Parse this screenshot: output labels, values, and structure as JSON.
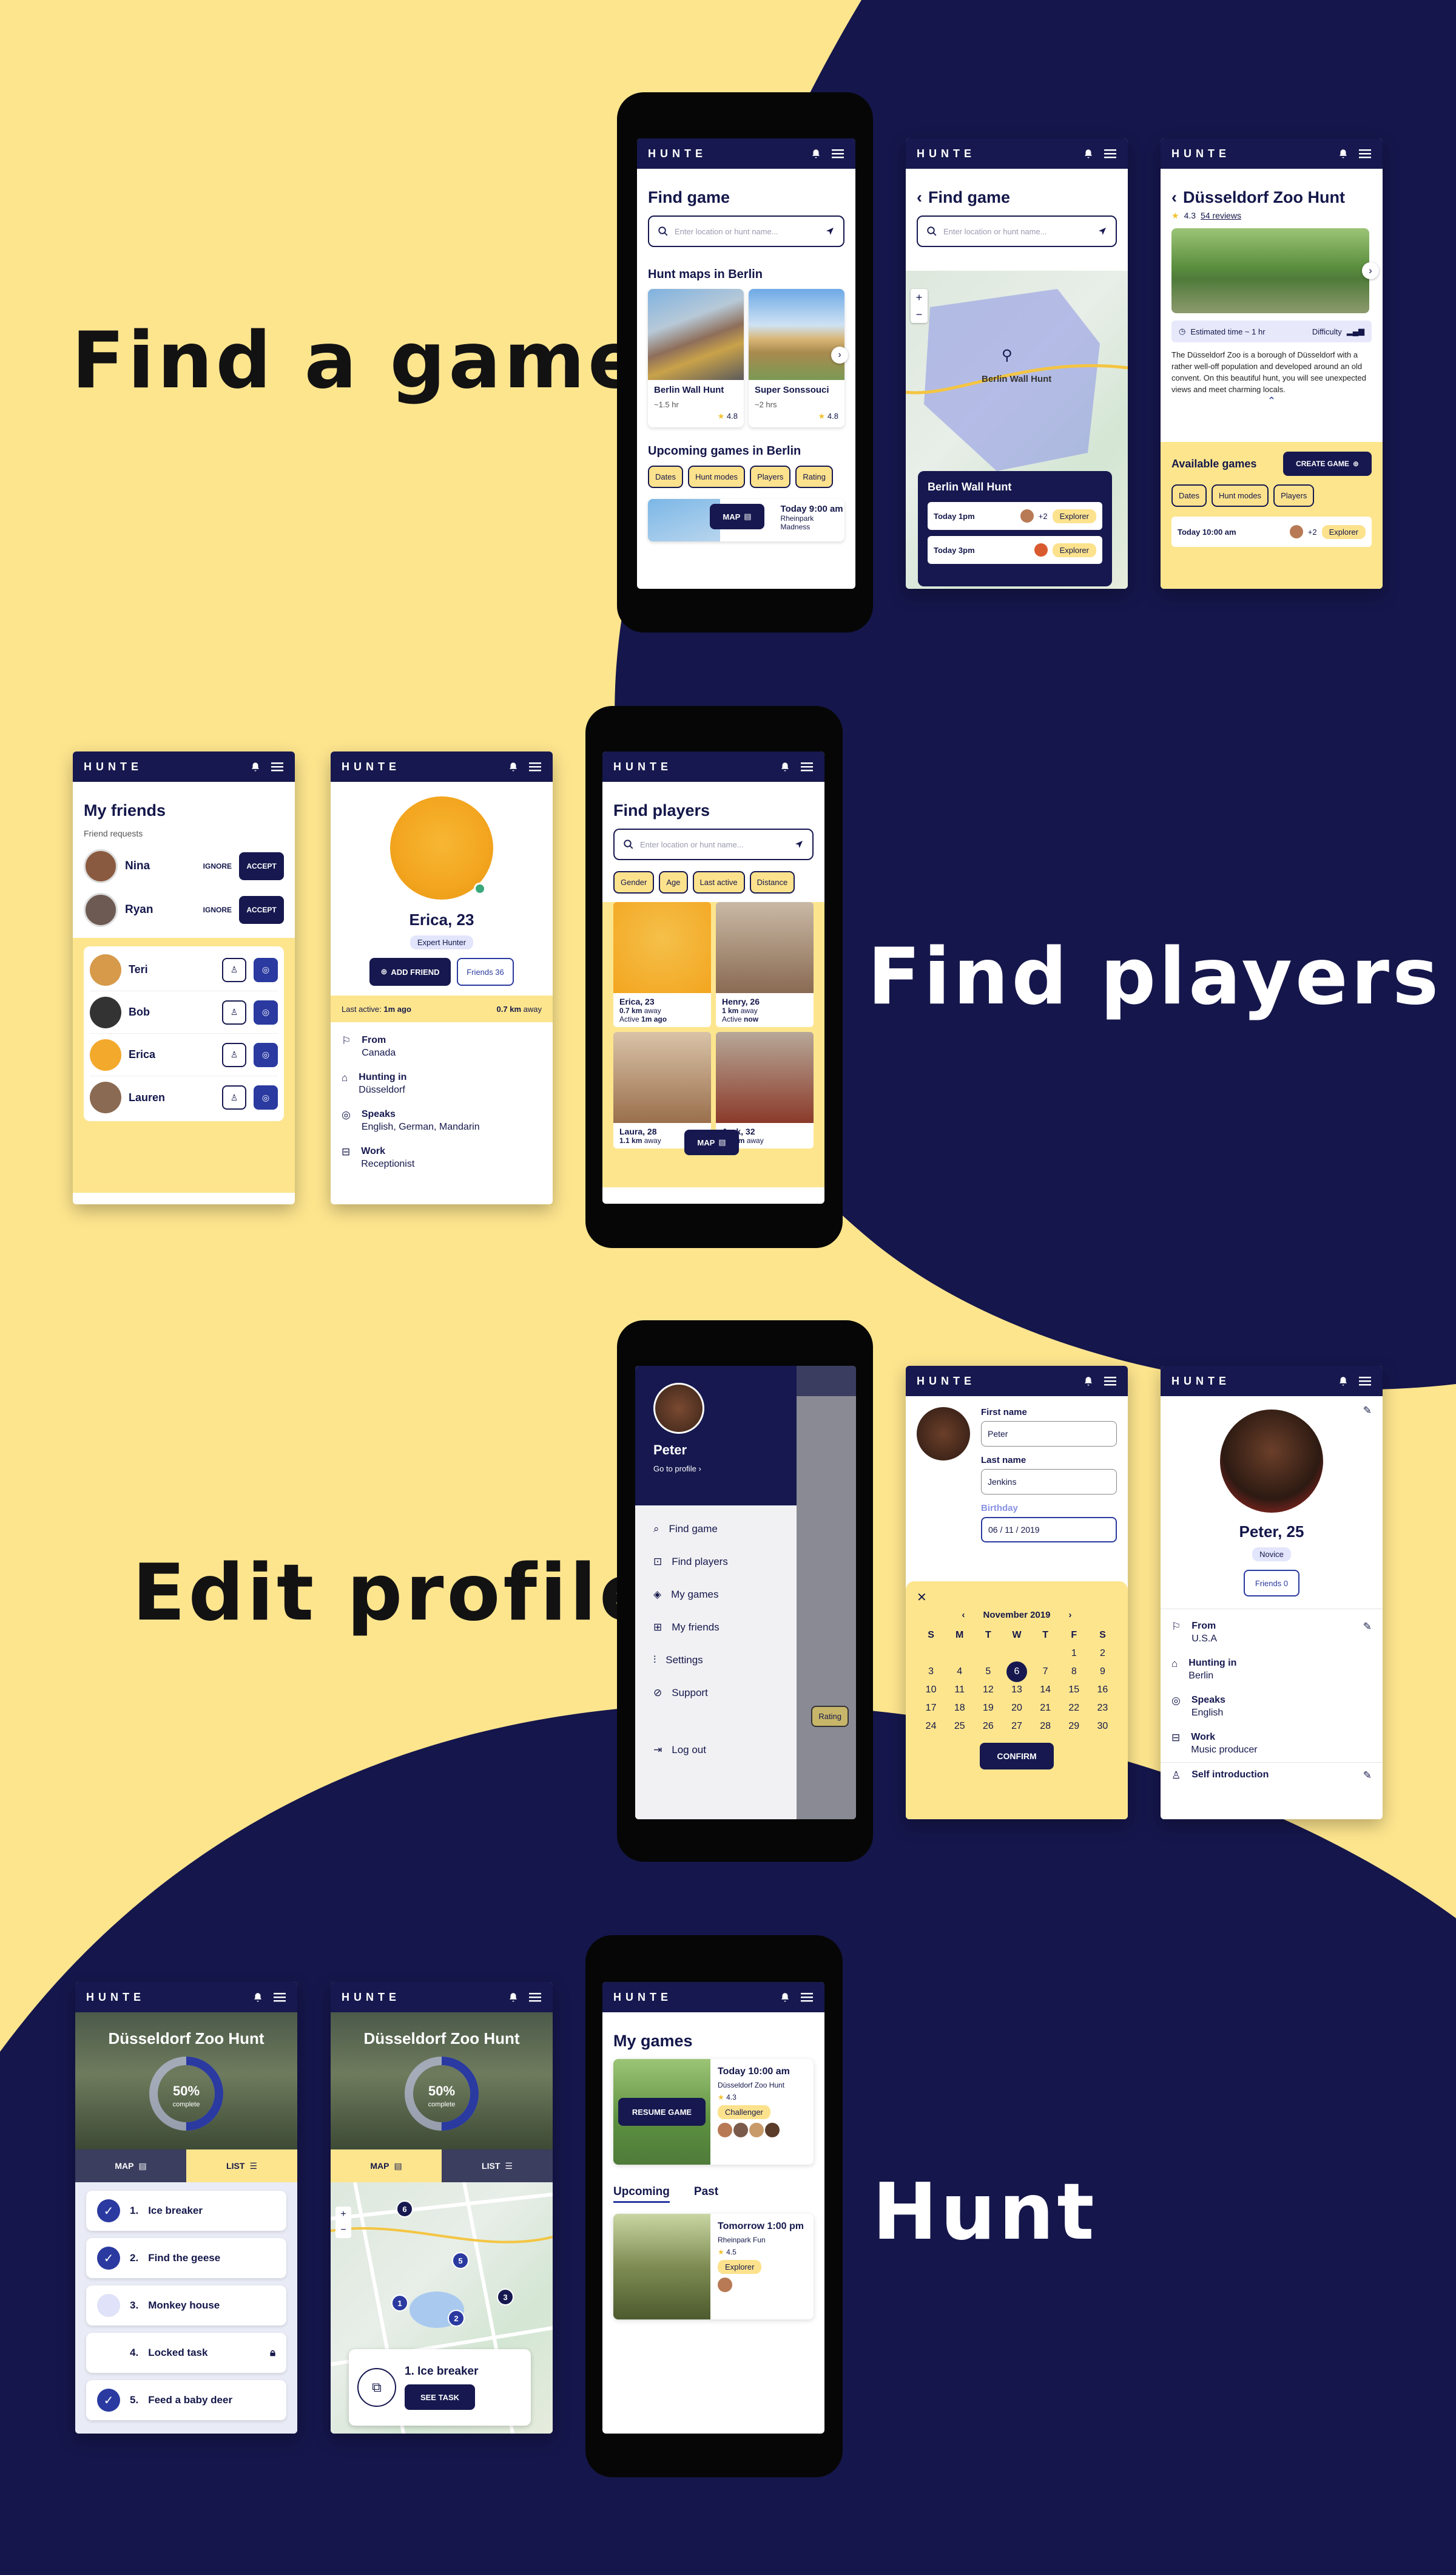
{
  "app": {
    "brand": "HUNTE"
  },
  "colors": {
    "navy": "#16184f",
    "yellow": "#fde58e",
    "accent": "#2a3aa0",
    "green": "#3aa87a"
  },
  "sections": {
    "find_game": "Find a game",
    "find_players": "Find players",
    "edit_profile": "Edit profile",
    "hunt": "Hunt"
  },
  "fg1": {
    "title": "Find game",
    "search_placeholder": "Enter location or hunt name...",
    "maps_heading": "Hunt maps in Berlin",
    "cards": [
      {
        "name": "Berlin Wall Hunt",
        "duration": "~1.5 hr",
        "rating": "4.8"
      },
      {
        "name": "Super Sonssouci",
        "duration": "~2 hrs",
        "rating": "4.8"
      }
    ],
    "upcoming_heading": "Upcoming games in Berlin",
    "filters": [
      "Dates",
      "Hunt modes",
      "Players",
      "Rating"
    ],
    "next_time": "Today 9:00 am",
    "next_place": "Rheinpark Madness",
    "map_button": "MAP"
  },
  "fg2": {
    "title": "Find game",
    "search_placeholder": "Enter location or hunt name...",
    "pin_label": "Berlin Wall Hunt",
    "sheet_title": "Berlin Wall Hunt",
    "slots": [
      {
        "time": "Today 1pm",
        "extra": "+2",
        "mode": "Explorer"
      },
      {
        "time": "Today 3pm",
        "extra": "",
        "mode": "Explorer"
      }
    ]
  },
  "fg3": {
    "title": "Düsseldorf Zoo Hunt",
    "rating": "4.3",
    "reviews": "54 reviews",
    "estimated": "Estimated time ~ 1 hr",
    "difficulty": "Difficulty",
    "description": "The Düsseldorf Zoo is a borough of Düsseldorf with a rather well-off population and developed around an old convent. On this beautiful hunt, you will see unexpected views and meet charming locals.",
    "available": "Available games",
    "create": "CREATE GAME",
    "filters": [
      "Dates",
      "Hunt modes",
      "Players"
    ],
    "slot_time": "Today 10:00 am",
    "slot_extra": "+2",
    "slot_mode": "Explorer"
  },
  "fp1": {
    "title": "My friends",
    "requests_label": "Friend requests",
    "ignore": "IGNORE",
    "accept": "ACCEPT",
    "requests": [
      "Nina",
      "Ryan"
    ],
    "friends": [
      "Teri",
      "Bob",
      "Erica",
      "Lauren"
    ]
  },
  "fp2": {
    "name": "Erica, 23",
    "badge": "Expert Hunter",
    "add": "ADD FRIEND",
    "friends": "Friends 36",
    "last_active_label": "Last active:",
    "last_active": "1m ago",
    "distance": "0.7 km",
    "distance_suffix": "away",
    "rows": [
      {
        "label": "From",
        "value": "Canada"
      },
      {
        "label": "Hunting in",
        "value": "Düsseldorf"
      },
      {
        "label": "Speaks",
        "value": "English, German, Mandarin"
      },
      {
        "label": "Work",
        "value": "Receptionist"
      }
    ]
  },
  "fp3": {
    "title": "Find players",
    "search_placeholder": "Enter location or hunt name...",
    "filters": [
      "Gender",
      "Age",
      "Last active",
      "Distance"
    ],
    "players": [
      {
        "name": "Erica, 23",
        "dist": "0.7 km",
        "active": "1m ago"
      },
      {
        "name": "Henry, 26",
        "dist": "1 km",
        "active": "now"
      },
      {
        "name": "Laura, 28",
        "dist": "1.1 km",
        "active": ""
      },
      {
        "name": "Jack, 32",
        "dist": "1.3 km",
        "active": ""
      }
    ],
    "away": "away",
    "active_prefix": "Active",
    "map_button": "MAP"
  },
  "ep1": {
    "name": "Peter",
    "go": "Go to profile",
    "menu": [
      "Find game",
      "Find players",
      "My games",
      "My friends",
      "Settings",
      "Support"
    ],
    "logout": "Log out",
    "rating_tag": "Rating"
  },
  "ep2": {
    "first_label": "First name",
    "first": "Peter",
    "last_label": "Last name",
    "last": "Jenkins",
    "birth_label": "Birthday",
    "birth": "06 / 11 / 2019",
    "month": "November 2019",
    "weekdays": [
      "S",
      "M",
      "T",
      "W",
      "T",
      "F",
      "S"
    ],
    "selected_day": "6",
    "confirm": "CONFIRM"
  },
  "ep3": {
    "name": "Peter, 25",
    "badge": "Novice",
    "friends": "Friends 0",
    "rows": [
      {
        "label": "From",
        "value": "U.S.A"
      },
      {
        "label": "Hunting in",
        "value": "Berlin"
      },
      {
        "label": "Speaks",
        "value": "English"
      },
      {
        "label": "Work",
        "value": "Music producer"
      }
    ],
    "intro": "Self introduction"
  },
  "h1": {
    "title": "Düsseldorf Zoo Hunt",
    "progress": "50%",
    "progress_value": 0.5,
    "complete": "complete",
    "map_tab": "MAP",
    "list_tab": "LIST",
    "tasks": [
      {
        "num": "1.",
        "name": "Ice breaker",
        "state": "done"
      },
      {
        "num": "2.",
        "name": "Find the geese",
        "state": "done"
      },
      {
        "num": "3.",
        "name": "Monkey house",
        "state": "current"
      },
      {
        "num": "4.",
        "name": "Locked task",
        "state": "locked"
      },
      {
        "num": "5.",
        "name": "Feed a baby deer",
        "state": "done"
      }
    ]
  },
  "h2": {
    "title": "Düsseldorf Zoo Hunt",
    "progress": "50%",
    "progress_value": 0.5,
    "complete": "complete",
    "map_tab": "MAP",
    "list_tab": "LIST",
    "card_task": "1.  Ice breaker",
    "see_task": "SEE TASK",
    "markers": [
      "6",
      "5",
      "3",
      "1",
      "2"
    ]
  },
  "h3": {
    "title": "My games",
    "g1_time": "Today 10:00 am",
    "g1_place": "Düsseldorf Zoo Hunt",
    "g1_rating": "4.3",
    "g1_mode": "Challenger",
    "resume": "RESUME GAME",
    "tab_upcoming": "Upcoming",
    "tab_past": "Past",
    "g2_time": "Tomorrow 1:00 pm",
    "g2_place": "Rheinpark Fun",
    "g2_rating": "4.5",
    "g2_mode": "Explorer"
  }
}
